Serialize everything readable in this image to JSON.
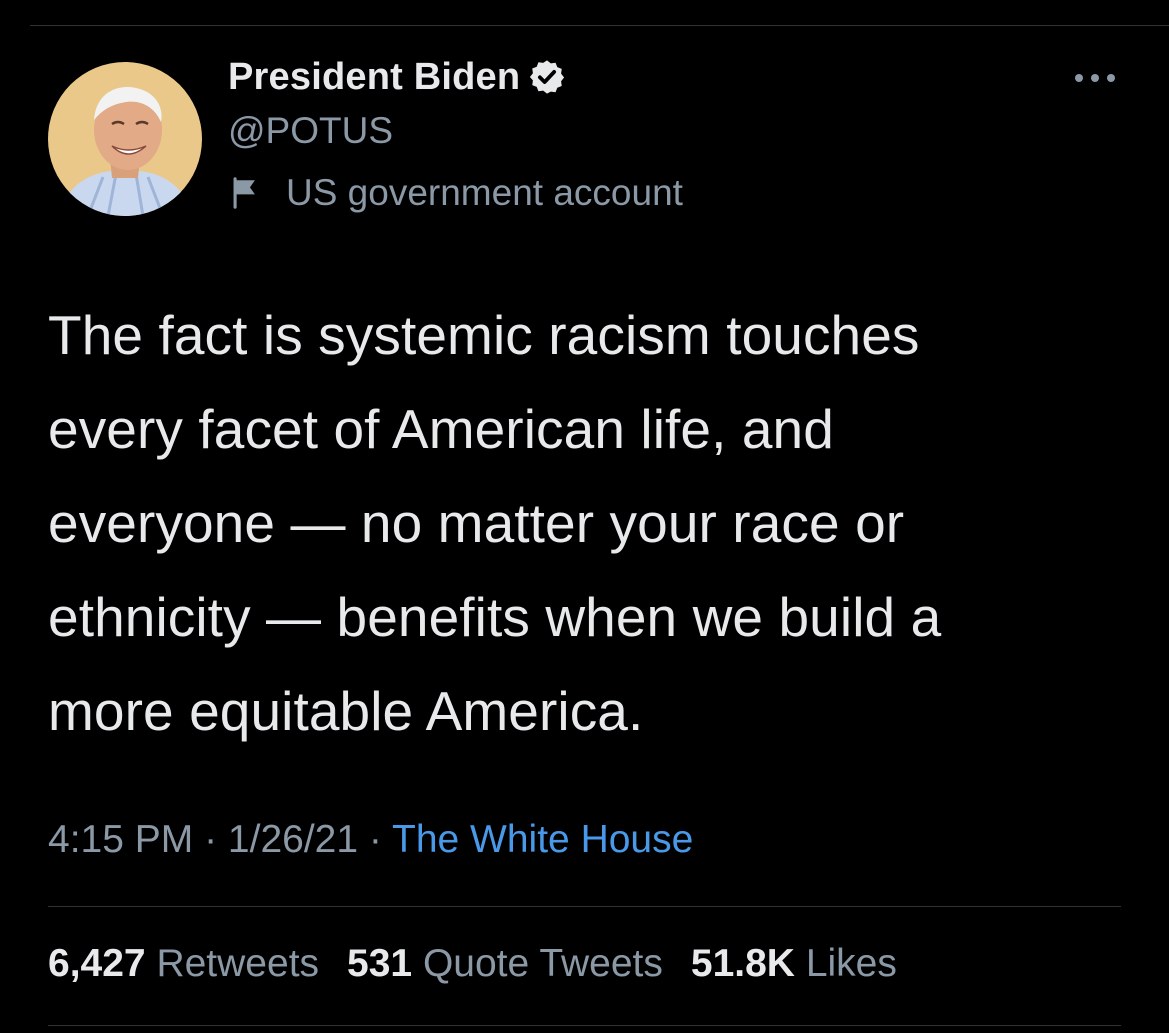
{
  "author": {
    "display_name": "President Biden",
    "handle": "@POTUS",
    "label": "US government account",
    "verified_icon": "verified-badge-icon",
    "label_icon": "flag-icon"
  },
  "tweet": {
    "text": "The fact is systemic racism touches\nevery facet of American life, and\neveryone — no matter your race or\nethnicity — benefits when we build a\nmore equitable America.",
    "time": "4:15 PM",
    "date": "1/26/21",
    "separator": "·",
    "source": "The White House"
  },
  "stats": {
    "retweets_count": "6,427",
    "retweets_label": "Retweets",
    "quotes_count": "531",
    "quotes_label": "Quote Tweets",
    "likes_count": "51.8K",
    "likes_label": "Likes"
  },
  "colors": {
    "background": "#000000",
    "primary_text": "#e7e9ea",
    "secondary_text": "#8b98a5",
    "link": "#4a99e9",
    "divider": "#2f3336"
  }
}
